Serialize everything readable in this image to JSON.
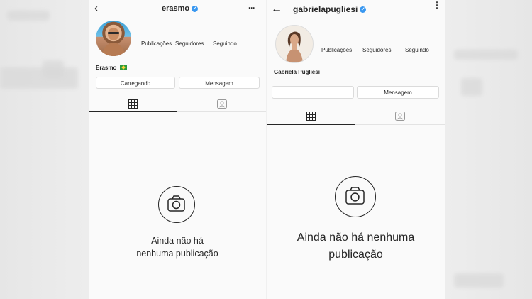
{
  "left_panel": {
    "username": "erasmo",
    "stats": [
      "Publicações",
      "Seguidores",
      "Seguindo"
    ],
    "display_name": "Erasmo",
    "loading_button": "Carregando",
    "message_button": "Mensagem",
    "empty_line1": "Ainda não há",
    "empty_line2": "nenhuma publicação"
  },
  "right_panel": {
    "username": "gabrielapugliesi",
    "stats": [
      "Publicações",
      "Seguidores",
      "Seguindo"
    ],
    "display_name": "Gabriela Pugliesi",
    "message_button": "Mensagem",
    "empty_line1": "Ainda não há nenhuma",
    "empty_line2": "publicação"
  },
  "colors": {
    "verified": "#3897f0",
    "text": "#262626",
    "panel_bg": "#fafafa"
  }
}
